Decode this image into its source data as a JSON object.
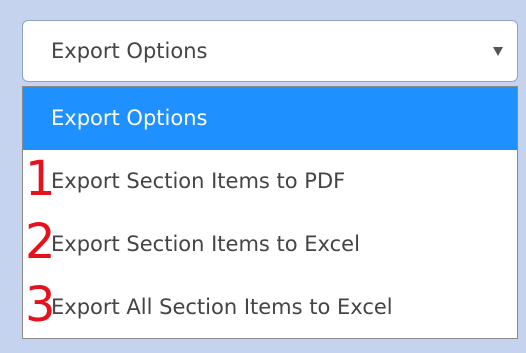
{
  "select": {
    "value": "Export Options"
  },
  "options": [
    {
      "label": "Export Options",
      "selected": true
    },
    {
      "label": "Export Section Items to PDF",
      "marker": "1"
    },
    {
      "label": "Export Section Items to Excel",
      "marker": "2"
    },
    {
      "label": "Export All Section Items to Excel",
      "marker": "3"
    }
  ],
  "colors": {
    "highlight": "#1e90ff",
    "marker": "#e5121e",
    "background": "#c5d3ee"
  },
  "icons": {
    "caret": "chevron-down-icon"
  }
}
